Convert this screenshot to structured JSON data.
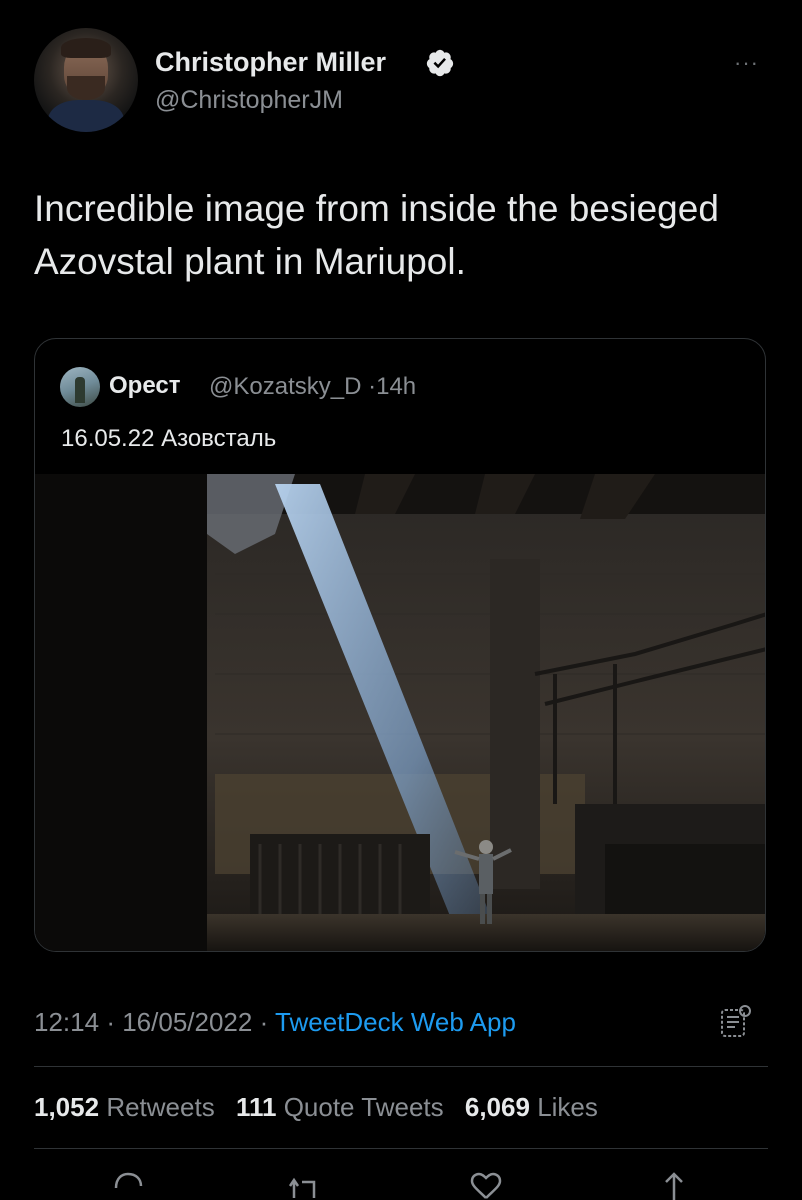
{
  "author": {
    "name": "Christopher Miller",
    "handle": "@ChristopherJM",
    "verified": true
  },
  "more_menu": "···",
  "tweet_text": "Incredible image from inside the besieged Azovstal plant in Mariupol.",
  "quoted": {
    "name": "Орест",
    "handle": "@Kozatsky_D",
    "separator": "·",
    "time": "14h",
    "text": "16.05.22 Азовсталь"
  },
  "meta": {
    "time": "12:14",
    "dot1": "·",
    "date": "16/05/2022",
    "dot2": "·",
    "source": "TweetDeck Web App"
  },
  "stats": {
    "retweets_count": "1,052",
    "retweets_label": "Retweets",
    "quotes_count": "111",
    "quotes_label": "Quote Tweets",
    "likes_count": "6,069",
    "likes_label": "Likes"
  },
  "icons": [
    "verified-badge-icon",
    "more-icon",
    "tweetdeck-icon",
    "reply-icon",
    "retweet-icon",
    "like-icon",
    "share-icon"
  ],
  "colors": {
    "background": "#000000",
    "link": "#1d9bf0",
    "secondary_text": "#8b8f94"
  }
}
